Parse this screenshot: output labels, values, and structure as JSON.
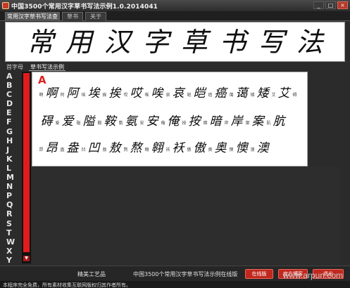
{
  "window": {
    "title": "中国3500个常用汉字草书写法示例1.0.2014041",
    "buttons": [
      "_",
      "□",
      "×"
    ]
  },
  "tabs": [
    {
      "label": "常用汉字草书写法查询",
      "active": true
    },
    {
      "label": "草书",
      "active": false
    },
    {
      "label": "关于",
      "active": false
    }
  ],
  "banner": {
    "chars": [
      "常",
      "用",
      "汉",
      "字",
      "草",
      "书",
      "写",
      "法"
    ]
  },
  "subtabs": [
    {
      "label": "首字母",
      "active": false
    },
    {
      "label": "草书写法示例",
      "active": true
    }
  ],
  "letters": [
    "A",
    "B",
    "C",
    "D",
    "E",
    "F",
    "G",
    "H",
    "J",
    "K",
    "L",
    "M",
    "N",
    "P",
    "Q",
    "R",
    "S",
    "T",
    "W",
    "X",
    "Y",
    "Z"
  ],
  "content": {
    "current_letter": "A",
    "rows": [
      [
        {
          "small": "啊",
          "cal": "啊"
        },
        {
          "small": "阿",
          "cal": "阿"
        },
        {
          "small": "埃",
          "cal": "埃"
        },
        {
          "small": "挨",
          "cal": "挨"
        },
        {
          "small": "哎",
          "cal": "哎"
        },
        {
          "small": "唉",
          "cal": "唉"
        },
        {
          "small": "哀",
          "cal": "哀"
        },
        {
          "small": "皑",
          "cal": "皑"
        },
        {
          "small": "癌",
          "cal": "癌"
        },
        {
          "small": "蔼",
          "cal": "蔼"
        },
        {
          "small": "矮",
          "cal": "矮"
        },
        {
          "small": "艾",
          "cal": "艾"
        },
        {
          "small": "碍",
          "cal": ""
        }
      ],
      [
        {
          "small": "",
          "cal": "碍"
        },
        {
          "small": "爱",
          "cal": "爱"
        },
        {
          "small": "隘",
          "cal": "隘"
        },
        {
          "small": "鞍",
          "cal": "鞍"
        },
        {
          "small": "氨",
          "cal": "氨"
        },
        {
          "small": "安",
          "cal": "安"
        },
        {
          "small": "俺",
          "cal": "俺"
        },
        {
          "small": "按",
          "cal": "按"
        },
        {
          "small": "暗",
          "cal": "暗"
        },
        {
          "small": "岸",
          "cal": "岸"
        },
        {
          "small": "案",
          "cal": "案"
        },
        {
          "small": "肮",
          "cal": "肮"
        }
      ],
      [
        {
          "small": "昂",
          "cal": "昂"
        },
        {
          "small": "盎",
          "cal": "盎"
        },
        {
          "small": "凹",
          "cal": "凹"
        },
        {
          "small": "敖",
          "cal": "敖"
        },
        {
          "small": "熬",
          "cal": "熬"
        },
        {
          "small": "翱",
          "cal": "翱"
        },
        {
          "small": "袄",
          "cal": "袄"
        },
        {
          "small": "傲",
          "cal": "傲"
        },
        {
          "small": "奥",
          "cal": "奥"
        },
        {
          "small": "懊",
          "cal": "懊"
        },
        {
          "small": "澳",
          "cal": "澳"
        }
      ]
    ]
  },
  "footer": {
    "left_text": "精美工艺品",
    "mid_text": "中国3500个常用汉字草书写法示例在线版",
    "buttons": [
      "在线版",
      "官方博客",
      "退出"
    ]
  },
  "status": {
    "text": "本程序完全免费，所有素材收集互联网版权归其作者所有。"
  },
  "watermark": "www.arpun.com"
}
